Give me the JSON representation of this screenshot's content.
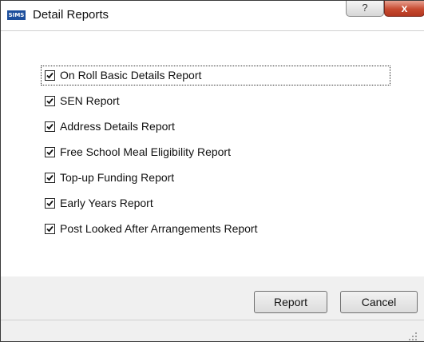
{
  "window": {
    "title": "Detail Reports",
    "app_icon_text": "SIMS",
    "help_glyph": "?",
    "close_glyph": "x"
  },
  "reports": [
    {
      "label": "On Roll Basic Details Report",
      "checked": true
    },
    {
      "label": "SEN Report",
      "checked": true
    },
    {
      "label": "Address Details Report",
      "checked": true
    },
    {
      "label": "Free School Meal Eligibility Report",
      "checked": true
    },
    {
      "label": "Top-up Funding Report",
      "checked": true
    },
    {
      "label": "Early Years Report",
      "checked": true
    },
    {
      "label": "Post Looked After Arrangements Report",
      "checked": true
    }
  ],
  "buttons": {
    "report": "Report",
    "cancel": "Cancel"
  },
  "colors": {
    "app_icon": "#1c4e9c",
    "close_button": "#c74a30"
  }
}
